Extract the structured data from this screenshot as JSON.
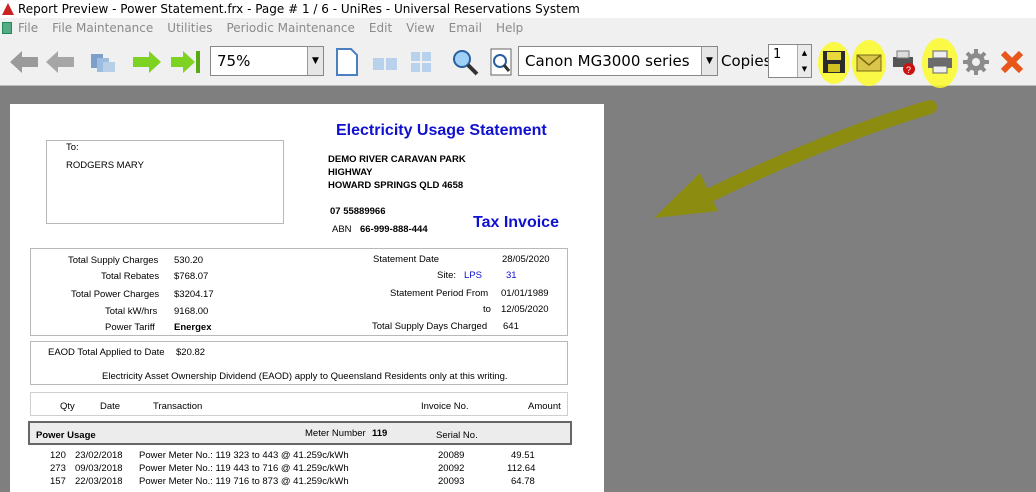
{
  "window": {
    "title": "Report Preview - Power Statement.frx - Page # 1 / 6 - UniRes - Universal Reservations System"
  },
  "menu": {
    "items": [
      "File",
      "File Maintenance",
      "Utilities",
      "Periodic Maintenance",
      "Edit",
      "View",
      "Email",
      "Help"
    ]
  },
  "toolbar": {
    "zoom_value": "75%",
    "printer_value": "Canon MG3000 series",
    "copies_label": "Copies",
    "copies_value": "1"
  },
  "icons": {
    "first": "first-page-icon",
    "prev": "prev-page-icon",
    "multi": "multi-page-icon",
    "next": "next-page-icon",
    "last": "last-page-icon",
    "single": "single-page-view-icon",
    "two": "two-page-view-icon",
    "four": "four-page-view-icon",
    "find": "find-icon",
    "preview": "print-preview-icon",
    "save": "save-icon",
    "email": "email-icon",
    "printer_help": "printer-help-icon",
    "print": "print-icon",
    "settings": "gear-icon",
    "close": "close-icon"
  },
  "colors": {
    "highlight": "#f0f020",
    "arrow": "#8c8c10",
    "report_blue": "#1010d0"
  },
  "report": {
    "heading": "Electricity Usage Statement",
    "to_label": "To:",
    "recipient": "RODGERS MARY",
    "business_lines": [
      "DEMO RIVER CARAVAN PARK",
      "HIGHWAY",
      "HOWARD SPRINGS QLD 4658"
    ],
    "phone": "07 55889966",
    "abn_label": "ABN",
    "abn": "66-999-888-444",
    "tax_invoice": "Tax Invoice",
    "summary_left": [
      {
        "label": "Total Supply Charges",
        "value": "530.20"
      },
      {
        "label": "Total Rebates",
        "value": "$768.07"
      },
      {
        "label": "Total Power Charges",
        "value": "$3204.17"
      },
      {
        "label": "Total kW/hrs",
        "value": "9168.00"
      },
      {
        "label": "Power Tariff",
        "value": "Energex"
      }
    ],
    "statement_date_label": "Statement Date",
    "statement_date": "28/05/2020",
    "site_label": "Site:",
    "site_code": "LPS",
    "site_no": "31",
    "period_label": "Statement Period From",
    "period_from": "01/01/1989",
    "to_word": "to",
    "period_to": "12/05/2020",
    "supply_days_label": "Total Supply Days Charged",
    "supply_days": "641",
    "eaod_label": "EAOD Total Applied to Date",
    "eaod_value": "$20.82",
    "eaod_note": "Electricity Asset Ownership Dividend (EAOD) apply to Queensland Residents only at this writing.",
    "table_headers": [
      "Qty",
      "Date",
      "Transaction",
      "Invoice No.",
      "Amount"
    ],
    "section_title": "Power Usage",
    "meter_label": "Meter Number",
    "meter_no": "119",
    "serial_label": "Serial No.",
    "rows": [
      {
        "qty": "120",
        "date": "23/02/2018",
        "tx": "Power Meter No.: 119 323 to 443 @  41.259c/kWh",
        "inv": "20089",
        "amt": "49.51"
      },
      {
        "qty": "273",
        "date": "09/03/2018",
        "tx": "Power Meter No.: 119 443 to 716 @  41.259c/kWh",
        "inv": "20092",
        "amt": "112.64"
      },
      {
        "qty": "157",
        "date": "22/03/2018",
        "tx": "Power Meter No.: 119 716 to 873 @  41.259c/kWh",
        "inv": "20093",
        "amt": "64.78"
      }
    ]
  }
}
